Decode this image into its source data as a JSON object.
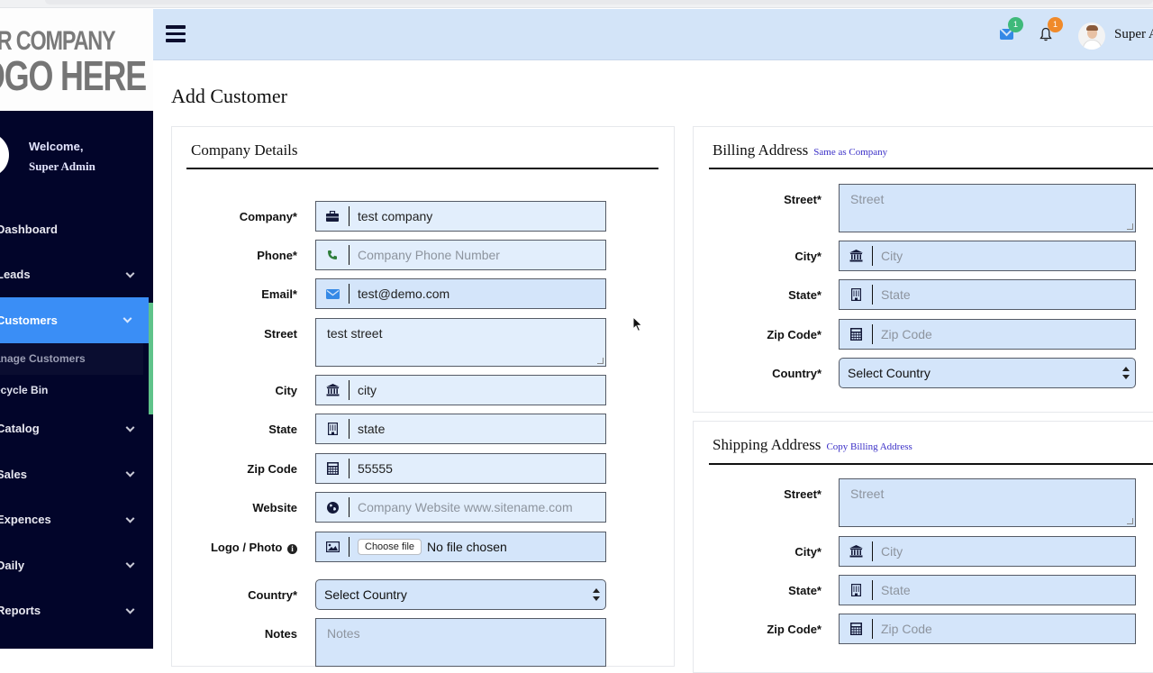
{
  "app": {
    "logo_line1": "UR COMPANY",
    "logo_line2": "OGO HERE"
  },
  "sidebar": {
    "welcome": "Welcome,",
    "user": "Super Admin",
    "items": [
      {
        "label": "Dashboard",
        "has_chevron": false
      },
      {
        "label": "Leads",
        "has_chevron": true
      },
      {
        "label": "Customers",
        "has_chevron": true,
        "active": true
      },
      {
        "label": "Catalog",
        "has_chevron": true
      },
      {
        "label": "Sales",
        "has_chevron": true
      },
      {
        "label": "Expences",
        "has_chevron": true
      },
      {
        "label": "Daily",
        "has_chevron": true
      },
      {
        "label": "Reports",
        "has_chevron": true
      }
    ],
    "sub_items": [
      {
        "label": "anage Customers",
        "current": true
      },
      {
        "label": "ecycle Bin",
        "current": false
      }
    ],
    "colors": {
      "background": "#02052a",
      "active": "#3a8ef6",
      "accent_bar": "#5fc38a"
    }
  },
  "header": {
    "mail_badge": "1",
    "bell_badge": "1",
    "user_name": "Super A",
    "colors": {
      "background": "#d3e4f8",
      "mail_badge": "#3fb97a",
      "bell_badge": "#f08a2a"
    }
  },
  "page": {
    "title": "Add Customer"
  },
  "company": {
    "title": "Company Details",
    "company_label": "Company*",
    "company_value": "test company",
    "phone_label": "Phone*",
    "phone_placeholder": "Company Phone Number",
    "email_label": "Email*",
    "email_value": "test@demo.com",
    "street_label": "Street",
    "street_value": "test street",
    "city_label": "City",
    "city_value": "city",
    "state_label": "State",
    "state_value": "state",
    "zip_label": "Zip Code",
    "zip_value": "55555",
    "website_label": "Website",
    "website_placeholder": "Company Website www.sitename.com",
    "logo_label": "Logo / Photo",
    "choose_file": "Choose file",
    "no_file": "No file chosen",
    "country_label": "Country*",
    "country_value": "Select Country",
    "notes_label": "Notes",
    "notes_placeholder": "Notes"
  },
  "billing": {
    "title": "Billing Address",
    "link": "Same as Company",
    "street_label": "Street*",
    "street_placeholder": "Street",
    "city_label": "City*",
    "city_placeholder": "City",
    "state_label": "State*",
    "state_placeholder": "State",
    "zip_label": "Zip Code*",
    "zip_placeholder": "Zip Code",
    "country_label": "Country*",
    "country_value": "Select Country"
  },
  "shipping": {
    "title": "Shipping Address",
    "link": "Copy Billing Address",
    "street_label": "Street*",
    "street_placeholder": "Street",
    "city_label": "City*",
    "city_placeholder": "City",
    "state_label": "State*",
    "state_placeholder": "State",
    "zip_label": "Zip Code*",
    "zip_placeholder": "Zip Code"
  }
}
